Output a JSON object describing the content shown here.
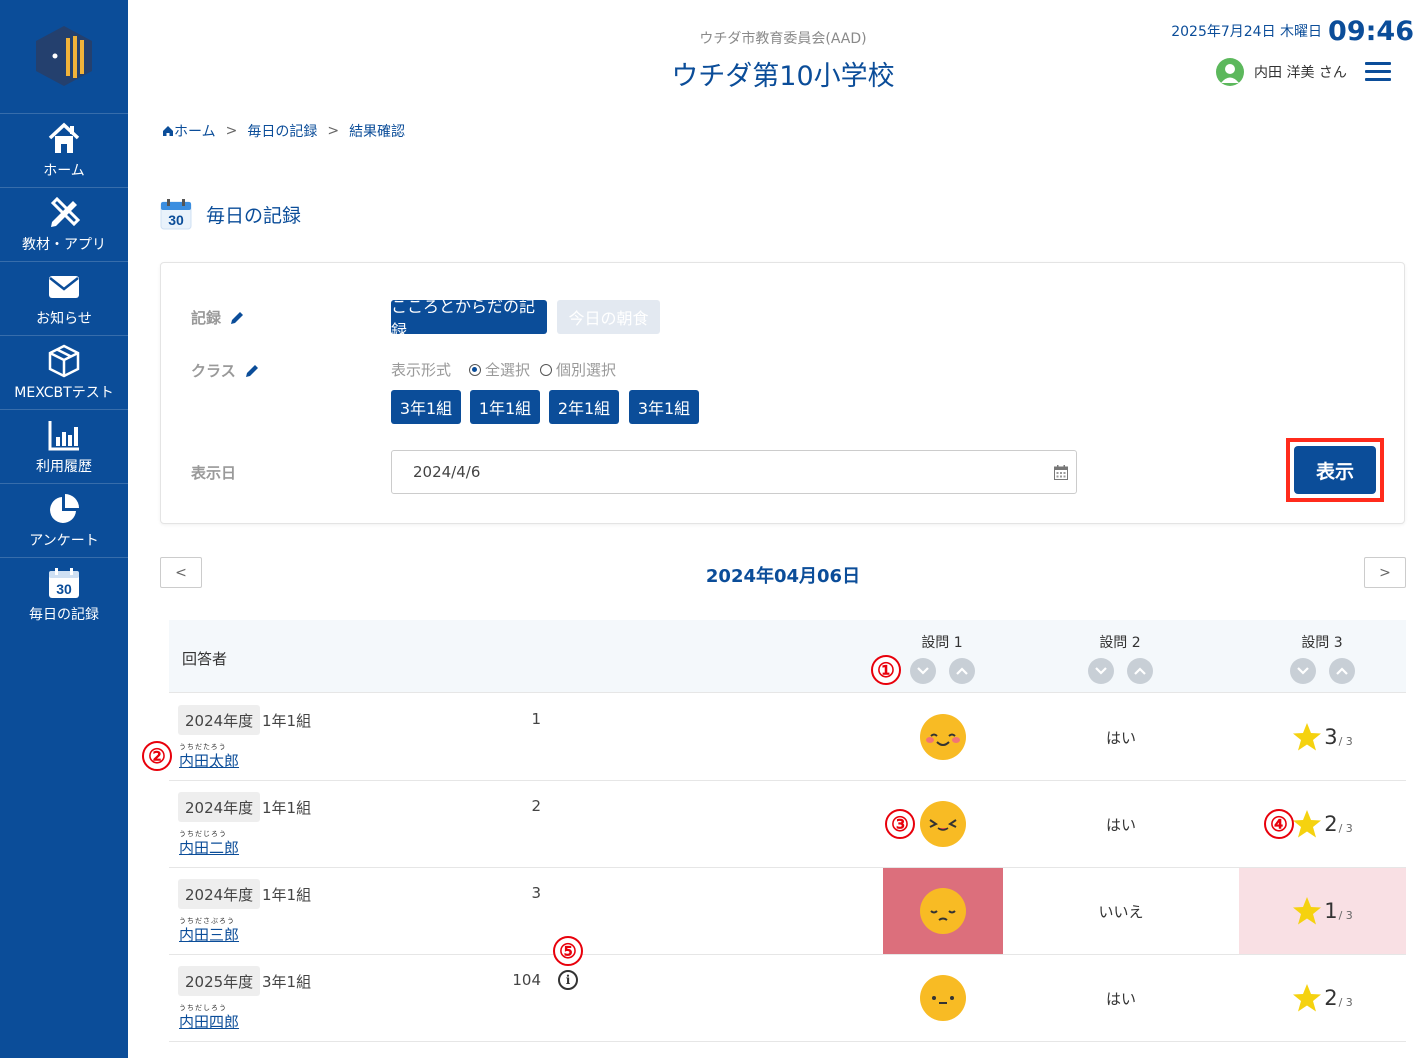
{
  "header": {
    "org": "ウチダ市教育委員会(AAD)",
    "school": "ウチダ第10小学校",
    "date": "2025年7月24日 木曜日",
    "time": "09:46",
    "user": "内田 洋美 さん"
  },
  "sidebar": {
    "items": [
      {
        "label": "ホーム",
        "icon": "home-icon"
      },
      {
        "label": "教材・アプリ",
        "icon": "pencil-ruler-icon"
      },
      {
        "label": "お知らせ",
        "icon": "envelope-icon"
      },
      {
        "label": "MEXCBTテスト",
        "icon": "cube-icon"
      },
      {
        "label": "利用履歴",
        "icon": "bar-chart-icon"
      },
      {
        "label": "アンケート",
        "icon": "pie-chart-icon"
      },
      {
        "label": "毎日の記録",
        "icon": "calendar-30-icon"
      }
    ]
  },
  "breadcrumb": {
    "home": "ホーム",
    "sep": ">",
    "daily": "毎日の記録",
    "current": "結果確認"
  },
  "page": {
    "title": "毎日の記録",
    "calendar_day": "30"
  },
  "filter": {
    "record_label": "記録",
    "record_active": "こころとからだの記録",
    "record_inactive": "今日の朝食",
    "class_label": "クラス",
    "display_format_label": "表示形式",
    "radio_all": "全選択",
    "radio_individual": "個別選択",
    "classes": [
      "3年1組",
      "1年1組",
      "2年1組",
      "3年1組"
    ],
    "date_label": "表示日",
    "date_value": "2024/4/6",
    "show_button": "表示"
  },
  "date_nav": {
    "prev": "<",
    "next": ">",
    "heading": "2024年04月06日"
  },
  "table": {
    "respondent_header": "回答者",
    "questions": [
      "設問 1",
      "設問 2",
      "設問 3"
    ],
    "rows": [
      {
        "year": "2024年度",
        "class": "1年1組",
        "ruby": "うちだたろう",
        "name": "内田太郎",
        "number": "1",
        "mood": "happy",
        "q2": "はい",
        "stars": "3",
        "stars_of": "/ 3",
        "flag_q1": false,
        "flag_q3": false
      },
      {
        "year": "2024年度",
        "class": "1年1組",
        "ruby": "うちだじろう",
        "name": "内田二郎",
        "number": "2",
        "mood": "squint",
        "q2": "はい",
        "stars": "2",
        "stars_of": "/ 3",
        "flag_q1": false,
        "flag_q3": false
      },
      {
        "year": "2024年度",
        "class": "1年1組",
        "ruby": "うちださぶろう",
        "name": "内田三郎",
        "number": "3",
        "mood": "sad",
        "q2": "いいえ",
        "stars": "1",
        "stars_of": "/ 3",
        "flag_q1": true,
        "flag_q3": true
      },
      {
        "year": "2025年度",
        "class": "3年1組",
        "ruby": "うちだしろう",
        "name": "内田四郎",
        "number": "104",
        "mood": "neutral",
        "q2": "はい",
        "stars": "2",
        "stars_of": "/ 3",
        "flag_q1": false,
        "flag_q3": false
      }
    ]
  },
  "callouts": [
    "①",
    "②",
    "③",
    "④",
    "⑤"
  ],
  "colors": {
    "brand": "#0b4d99",
    "highlight": "#ff2b1c",
    "alert_cell": "#dc6f7c",
    "warn_cell": "#f9e0e4",
    "face": "#f8bb24"
  }
}
